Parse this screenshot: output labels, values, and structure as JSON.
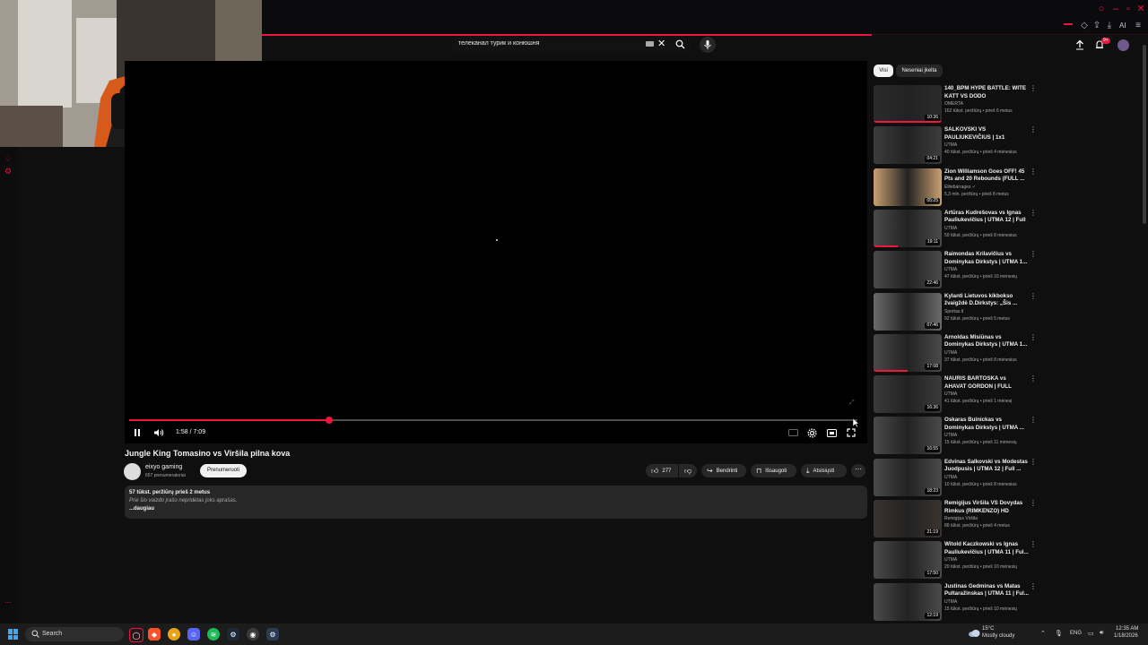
{
  "search": {
    "query": "телеканал турик и конюшня"
  },
  "notifications": {
    "badge": "9+"
  },
  "browser": {
    "ai_label": "AI"
  },
  "player": {
    "current_time": "1:58",
    "total_time": "7:09",
    "time_display": "1:58 / 7:09",
    "progress_fraction": 0.275
  },
  "video": {
    "title": "Jungle King Tomasino vs Viršila pilna kova",
    "channel": "eixyo gaming",
    "subscribers": "657 prenumeratoriai",
    "subscribe_label": "Prenumeruoti",
    "likes": "277",
    "share_label": "Bendrinti",
    "save_label": "Išsaugoti",
    "download_label": "Atsisiųsti",
    "views_line": "57 tūkst. peržiūrų  prieš 2 metus",
    "description": "Prie šio vaizdo įrašo nepridėtas joks aprašas.",
    "more_label": "...daugiau"
  },
  "sidebar": {
    "chips": [
      "Visi",
      "Neseniai įkelta"
    ],
    "items": [
      {
        "title": "140_BPM HYPE BATTLE: WITE KATT VS DODO",
        "channel": "OMERTA",
        "meta": "162 tūkst. peržiūrų • prieš 6 metus",
        "duration": "10:36",
        "watched": 1.0
      },
      {
        "title": "ŠALKOVSKI VS PAULIUKEVIČIUS | 1x1",
        "channel": "UTMA",
        "meta": "40 tūkst. peržiūrų • prieš 4 mėnesius",
        "duration": "04:21",
        "watched": 0
      },
      {
        "title": "Zion Williamson Goes OFF! 45 Pts and 20 Rebounds (FULL ...",
        "channel": "Elitebarrages ✓",
        "meta": "5,3 mln. peržiūrų • prieš 8 metus",
        "duration": "05:25",
        "watched": 0
      },
      {
        "title": "Artūras Kudrešovas vs Ignas Pauliukevičius | UTMA 12 | Full ...",
        "channel": "UTMA",
        "meta": "59 tūkst. peržiūrų • prieš 8 mėnesius",
        "duration": "19:11",
        "watched": 0.35
      },
      {
        "title": "Raimondas Krilavičius vs Dominykas Dirkstys | UTMA 1...",
        "channel": "UTMA",
        "meta": "47 tūkst. peržiūrų • prieš 10 mėnesių",
        "duration": "22:46",
        "watched": 0
      },
      {
        "title": "Kylanti Lietuvos kikbokso žvaigždė D.Dirkstys: „Šis ...",
        "channel": "Sportas.lt",
        "meta": "92 tūkst. peržiūrų • prieš 5 metus",
        "duration": "07:46",
        "watched": 0
      },
      {
        "title": "Arnoldas Misiūnas vs Dominykas Dirkstys | UTMA 1...",
        "channel": "UTMA",
        "meta": "37 tūkst. peržiūrų • prieš 8 mėnesius",
        "duration": "17:08",
        "watched": 0.5
      },
      {
        "title": "NAURIS BARTOŠKA vs AHAVAT GORDON | FULL FIGHT | UTMA...",
        "channel": "UTMA",
        "meta": "41 tūkst. peržiūrų • prieš 1 mėnesį",
        "duration": "16:36",
        "watched": 0
      },
      {
        "title": "Oskaras Buinickas vs Dominykas Dirkstys | UTMA ...",
        "channel": "UTMA",
        "meta": "15 tūkst. peržiūrų • prieš 11 mėnesių",
        "duration": "16:55",
        "watched": 0
      },
      {
        "title": "Edvinas Šalkovski vs Modestas Juodpusis | UTMA 12 | Full ...",
        "channel": "UTMA",
        "meta": "10 tūkst. peržiūrų • prieš 8 mėnesius",
        "duration": "18:23",
        "watched": 0
      },
      {
        "title": "Remigijus Viršila VS Dovydas Rimkus (RIMKENZO) HD",
        "channel": "Remigijus Viršila",
        "meta": "86 tūkst. peržiūrų • prieš 4 metus",
        "duration": "21:19",
        "watched": 0
      },
      {
        "title": "Witold Kaczkowski vs Ignas Pauliukevičius | UTMA 11 | Ful...",
        "channel": "UTMA",
        "meta": "20 tūkst. peržiūrų • prieš 10 mėnesių",
        "duration": "17:50",
        "watched": 0
      },
      {
        "title": "Justinas Gedminas vs Matas Pultaražinskas | UTMA 11 | Ful...",
        "channel": "UTMA",
        "meta": "15 tūkst. peržiūrų • prieš 10 mėnesių",
        "duration": "12:19",
        "watched": 0
      }
    ]
  },
  "taskbar": {
    "search_label": "Search",
    "weather_temp": "15°C",
    "weather_cond": "Mostly cloudy",
    "language": "ENG",
    "time": "12:35 AM",
    "date": "1/18/2026"
  },
  "colors": {
    "accent": "#f1173c",
    "background": "#0f0f0f",
    "chip_bg": "#272727"
  }
}
